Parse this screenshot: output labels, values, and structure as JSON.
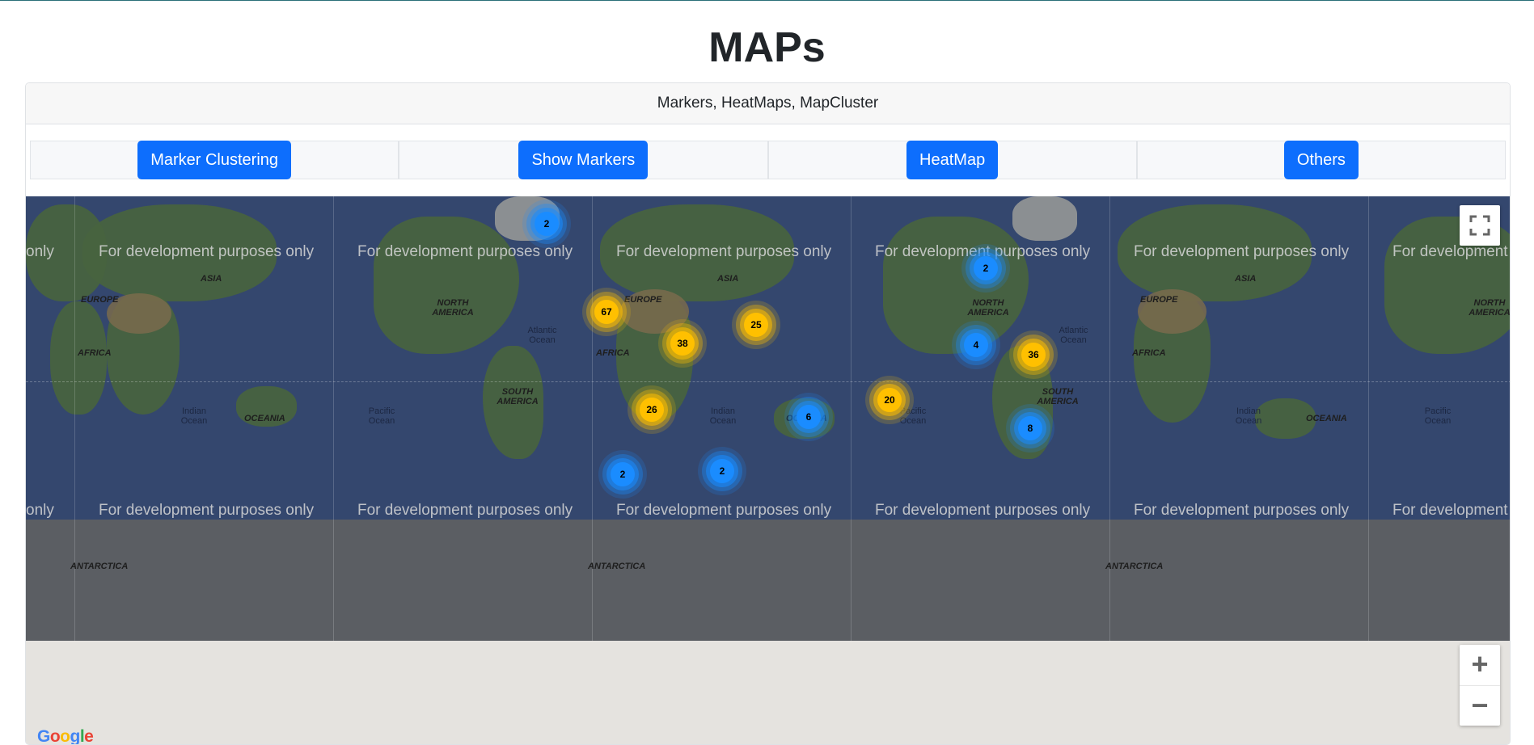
{
  "page": {
    "title": "MAPs"
  },
  "card": {
    "header": "Markers, HeatMaps, MapCluster"
  },
  "buttons": [
    {
      "label": "Marker Clustering"
    },
    {
      "label": "Show Markers"
    },
    {
      "label": "HeatMap"
    },
    {
      "label": "Others"
    }
  ],
  "map": {
    "watermark": "For development purposes only",
    "watermark_cut_left": "only",
    "watermark_cut_right": "For development",
    "labels": {
      "europe": "EUROPE",
      "asia": "ASIA",
      "africa": "AFRICA",
      "oceania": "OCEANIA",
      "north_america": "NORTH AMERICA",
      "south_america": "SOUTH AMERICA",
      "antarctica": "ANTARCTICA",
      "atlantic": "Atlantic Ocean",
      "pacific": "Pacific Ocean",
      "indian": "Indian Ocean"
    },
    "clusters": [
      {
        "count": "2",
        "color": "blue"
      },
      {
        "count": "2",
        "color": "blue"
      },
      {
        "count": "67",
        "color": "yellow"
      },
      {
        "count": "25",
        "color": "yellow"
      },
      {
        "count": "38",
        "color": "yellow"
      },
      {
        "count": "4",
        "color": "blue"
      },
      {
        "count": "36",
        "color": "yellow"
      },
      {
        "count": "20",
        "color": "yellow"
      },
      {
        "count": "26",
        "color": "yellow"
      },
      {
        "count": "6",
        "color": "blue"
      },
      {
        "count": "8",
        "color": "blue"
      },
      {
        "count": "2",
        "color": "blue"
      },
      {
        "count": "2",
        "color": "blue"
      }
    ],
    "controls": {
      "fullscreen_icon": "fullscreen-icon",
      "zoom_in": "+",
      "zoom_out": "−"
    },
    "brand": "Google"
  },
  "colors": {
    "primary": "#0d6efd",
    "cluster_blue": "#1a8cff",
    "cluster_yellow": "#ffc000"
  }
}
